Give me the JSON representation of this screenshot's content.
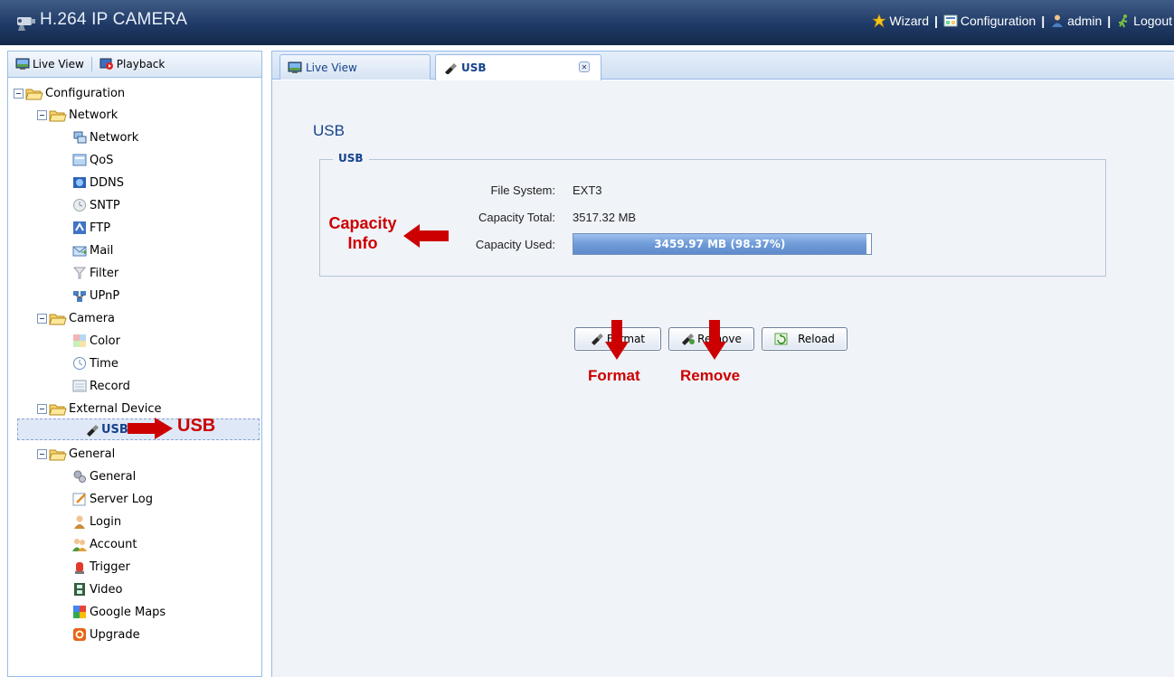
{
  "header": {
    "title": "H.264 IP CAMERA",
    "nav": [
      {
        "label": "Wizard",
        "icon": "wizard-icon"
      },
      {
        "label": "Configuration",
        "icon": "configuration-icon"
      },
      {
        "label": "admin",
        "icon": "user-icon"
      },
      {
        "label": "Logout",
        "icon": "logout-icon"
      }
    ]
  },
  "sidebar": {
    "tabs": [
      {
        "label": "Live View",
        "icon": "live-view-icon"
      },
      {
        "label": "Playback",
        "icon": "playback-icon"
      }
    ],
    "tree": [
      {
        "label": "Configuration",
        "level": 0,
        "type": "folder"
      },
      {
        "label": "Network",
        "level": 1,
        "type": "folder"
      },
      {
        "label": "Network",
        "level": 2,
        "type": "leaf",
        "icon": "network-icon"
      },
      {
        "label": "QoS",
        "level": 2,
        "type": "leaf",
        "icon": "qos-icon"
      },
      {
        "label": "DDNS",
        "level": 2,
        "type": "leaf",
        "icon": "ddns-icon"
      },
      {
        "label": "SNTP",
        "level": 2,
        "type": "leaf",
        "icon": "sntp-icon"
      },
      {
        "label": "FTP",
        "level": 2,
        "type": "leaf",
        "icon": "ftp-icon"
      },
      {
        "label": "Mail",
        "level": 2,
        "type": "leaf",
        "icon": "mail-icon"
      },
      {
        "label": "Filter",
        "level": 2,
        "type": "leaf",
        "icon": "filter-icon"
      },
      {
        "label": "UPnP",
        "level": 2,
        "type": "leaf",
        "icon": "upnp-icon"
      },
      {
        "label": "Camera",
        "level": 1,
        "type": "folder"
      },
      {
        "label": "Color",
        "level": 2,
        "type": "leaf",
        "icon": "color-icon"
      },
      {
        "label": "Time",
        "level": 2,
        "type": "leaf",
        "icon": "time-icon"
      },
      {
        "label": "Record",
        "level": 2,
        "type": "leaf",
        "icon": "record-icon"
      },
      {
        "label": "External Device",
        "level": 1,
        "type": "folder"
      },
      {
        "label": "USB",
        "level": 2,
        "type": "leaf",
        "icon": "usb-icon",
        "selected": true
      },
      {
        "label": "General",
        "level": 1,
        "type": "folder"
      },
      {
        "label": "General",
        "level": 2,
        "type": "leaf",
        "icon": "general-icon"
      },
      {
        "label": "Server Log",
        "level": 2,
        "type": "leaf",
        "icon": "server-log-icon"
      },
      {
        "label": "Login",
        "level": 2,
        "type": "leaf",
        "icon": "login-icon"
      },
      {
        "label": "Account",
        "level": 2,
        "type": "leaf",
        "icon": "account-icon"
      },
      {
        "label": "Trigger",
        "level": 2,
        "type": "leaf",
        "icon": "trigger-icon"
      },
      {
        "label": "Video",
        "level": 2,
        "type": "leaf",
        "icon": "video-icon"
      },
      {
        "label": "Google Maps",
        "level": 2,
        "type": "leaf",
        "icon": "google-maps-icon"
      },
      {
        "label": "Upgrade",
        "level": 2,
        "type": "leaf",
        "icon": "upgrade-icon"
      }
    ]
  },
  "main": {
    "tabs": [
      {
        "label": "Live View",
        "icon": "live-view-icon"
      },
      {
        "label": "USB",
        "icon": "usb-icon",
        "closable": true
      }
    ],
    "page_title": "USB",
    "fieldset_legend": "USB",
    "fields": {
      "file_system_label": "File System:",
      "file_system_value": "EXT3",
      "capacity_total_label": "Capacity Total:",
      "capacity_total_value": "3517.32 MB",
      "capacity_used_label": "Capacity Used:",
      "capacity_used_text": "3459.97 MB (98.37%)",
      "capacity_used_fraction": 0.9837
    },
    "buttons": {
      "format": "Format",
      "remove": "Remove",
      "reload": "Reload"
    }
  },
  "annotations": {
    "capacity_line1": "Capacity",
    "capacity_line2": "Info",
    "usb": "USB",
    "format": "Format",
    "remove": "Remove"
  },
  "colors": {
    "header_bg": "#1f3a66",
    "accent": "#15428b",
    "annotation_red": "#cc0000",
    "progress_fill": "#6f9bd8"
  }
}
